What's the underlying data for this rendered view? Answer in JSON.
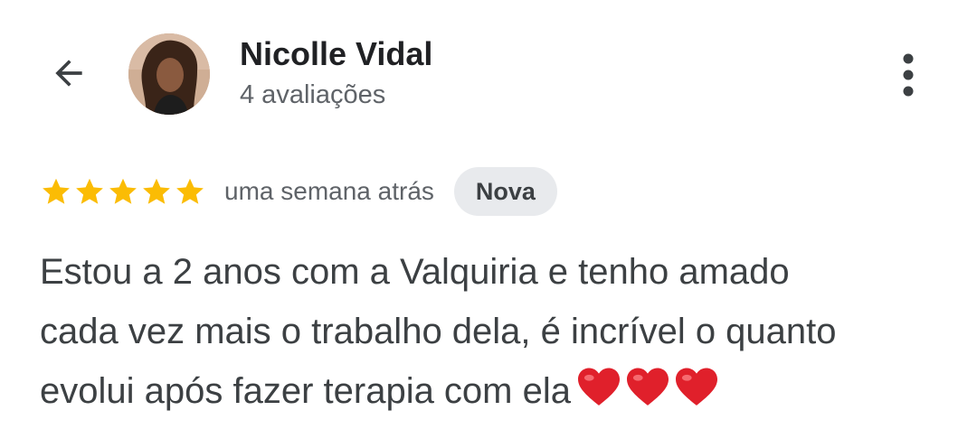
{
  "header": {
    "reviewer_name": "Nicolle Vidal",
    "review_count": "4 avaliações",
    "back_icon": "arrow-back-icon",
    "more_icon": "more-vert-icon"
  },
  "review": {
    "rating": 5,
    "max_rating": 5,
    "time": "uma semana atrás",
    "badge": "Nova",
    "text_lines": [
      "Estou a 2 anos com a Valquiria e tenho amado",
      "cada vez mais o trabalho dela, é incrível o quanto",
      "evolui após fazer terapia com ela"
    ],
    "emoji_count": 3,
    "emoji_icon": "red-heart-icon"
  },
  "colors": {
    "star": "#fbbc04",
    "text": "#3c4043",
    "secondary_text": "#5f6368",
    "badge_bg": "#e8eaed",
    "heart": "#e0202b"
  }
}
